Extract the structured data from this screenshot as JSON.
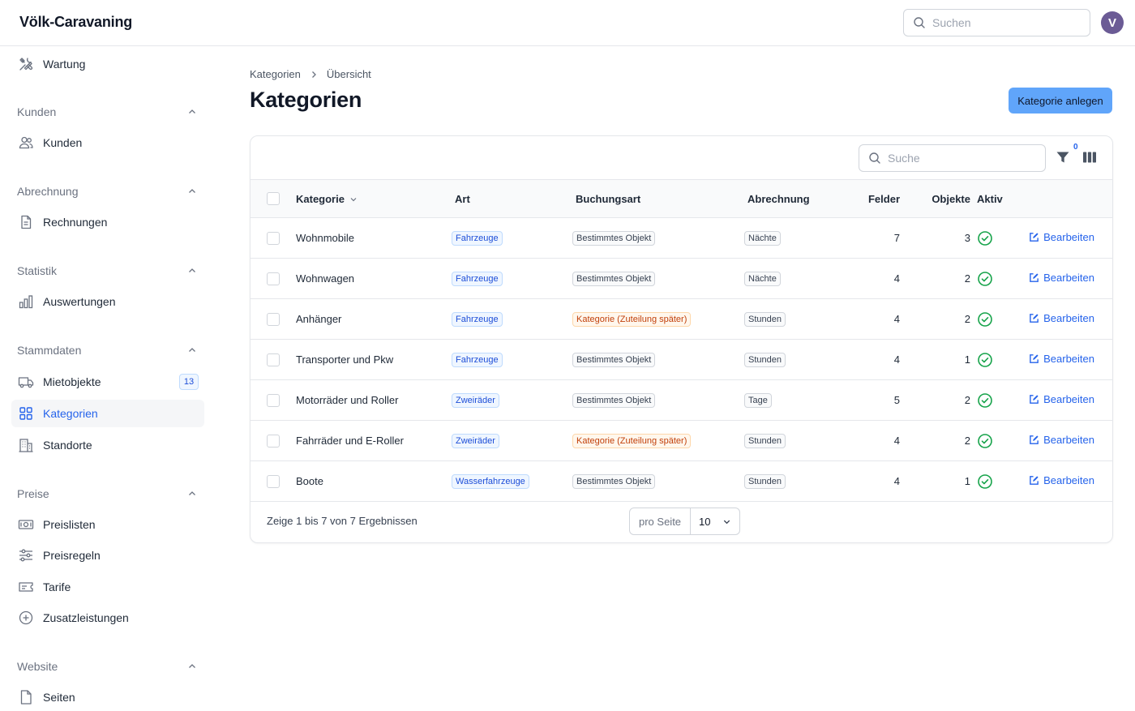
{
  "app": {
    "title": "Völk-Caravaning"
  },
  "topbar": {
    "search_placeholder": "Suchen",
    "avatar_initial": "V"
  },
  "sidebar": {
    "top_item": {
      "label": "Wartung",
      "icon": "tools-icon"
    },
    "sections": [
      {
        "title": "Kunden",
        "items": [
          {
            "label": "Kunden",
            "icon": "users-icon"
          }
        ]
      },
      {
        "title": "Abrechnung",
        "items": [
          {
            "label": "Rechnungen",
            "icon": "document-icon"
          }
        ]
      },
      {
        "title": "Statistik",
        "items": [
          {
            "label": "Auswertungen",
            "icon": "bar-chart-icon"
          }
        ]
      },
      {
        "title": "Stammdaten",
        "items": [
          {
            "label": "Mietobjekte",
            "icon": "truck-icon",
            "badge": "13"
          },
          {
            "label": "Kategorien",
            "icon": "grid-icon",
            "active": true
          },
          {
            "label": "Standorte",
            "icon": "building-icon"
          }
        ]
      },
      {
        "title": "Preise",
        "items": [
          {
            "label": "Preislisten",
            "icon": "banknote-icon"
          },
          {
            "label": "Preisregeln",
            "icon": "sliders-icon"
          },
          {
            "label": "Tarife",
            "icon": "ticket-icon"
          },
          {
            "label": "Zusatzleistungen",
            "icon": "plus-circle-icon"
          }
        ]
      },
      {
        "title": "Website",
        "items": [
          {
            "label": "Seiten",
            "icon": "page-icon"
          }
        ]
      }
    ]
  },
  "breadcrumb": {
    "parent": "Kategorien",
    "current": "Übersicht"
  },
  "page": {
    "title": "Kategorien",
    "create_button": "Kategorie anlegen"
  },
  "table": {
    "search_placeholder": "Suche",
    "filter_count": "0",
    "columns": {
      "kategorie": "Kategorie",
      "art": "Art",
      "buchungsart": "Buchungsart",
      "abrechnung": "Abrechnung",
      "felder": "Felder",
      "objekte": "Objekte",
      "aktiv": "Aktiv"
    },
    "rows": [
      {
        "kategorie": "Wohnmobile",
        "art": "Fahrzeuge",
        "buchungsart": "Bestimmtes Objekt",
        "buchungsart_style": "gray",
        "abrechnung": "Nächte",
        "felder": "7",
        "objekte": "3",
        "aktiv": true,
        "edit": "Bearbeiten"
      },
      {
        "kategorie": "Wohnwagen",
        "art": "Fahrzeuge",
        "buchungsart": "Bestimmtes Objekt",
        "buchungsart_style": "gray",
        "abrechnung": "Nächte",
        "felder": "4",
        "objekte": "2",
        "aktiv": true,
        "edit": "Bearbeiten"
      },
      {
        "kategorie": "Anhänger",
        "art": "Fahrzeuge",
        "buchungsart": "Kategorie (Zuteilung später)",
        "buchungsart_style": "orange",
        "abrechnung": "Stunden",
        "felder": "4",
        "objekte": "2",
        "aktiv": true,
        "edit": "Bearbeiten"
      },
      {
        "kategorie": "Transporter und Pkw",
        "art": "Fahrzeuge",
        "buchungsart": "Bestimmtes Objekt",
        "buchungsart_style": "gray",
        "abrechnung": "Stunden",
        "felder": "4",
        "objekte": "1",
        "aktiv": true,
        "edit": "Bearbeiten"
      },
      {
        "kategorie": "Motorräder und Roller",
        "art": "Zweiräder",
        "buchungsart": "Bestimmtes Objekt",
        "buchungsart_style": "gray",
        "abrechnung": "Tage",
        "felder": "5",
        "objekte": "2",
        "aktiv": true,
        "edit": "Bearbeiten"
      },
      {
        "kategorie": "Fahrräder und E-Roller",
        "art": "Zweiräder",
        "buchungsart": "Kategorie (Zuteilung später)",
        "buchungsart_style": "orange",
        "abrechnung": "Stunden",
        "felder": "4",
        "objekte": "2",
        "aktiv": true,
        "edit": "Bearbeiten"
      },
      {
        "kategorie": "Boote",
        "art": "Wasserfahrzeuge",
        "buchungsart": "Bestimmtes Objekt",
        "buchungsart_style": "gray",
        "abrechnung": "Stunden",
        "felder": "4",
        "objekte": "1",
        "aktiv": true,
        "edit": "Bearbeiten"
      }
    ],
    "footer": {
      "results": "Zeige 1 bis 7 von 7 Ergebnissen",
      "per_page_label": "pro Seite",
      "per_page_value": "10"
    }
  },
  "colors": {
    "accent": "#2563eb",
    "button_bg": "#60a5fa",
    "success": "#16a34a",
    "avatar": "#6b5b95"
  }
}
